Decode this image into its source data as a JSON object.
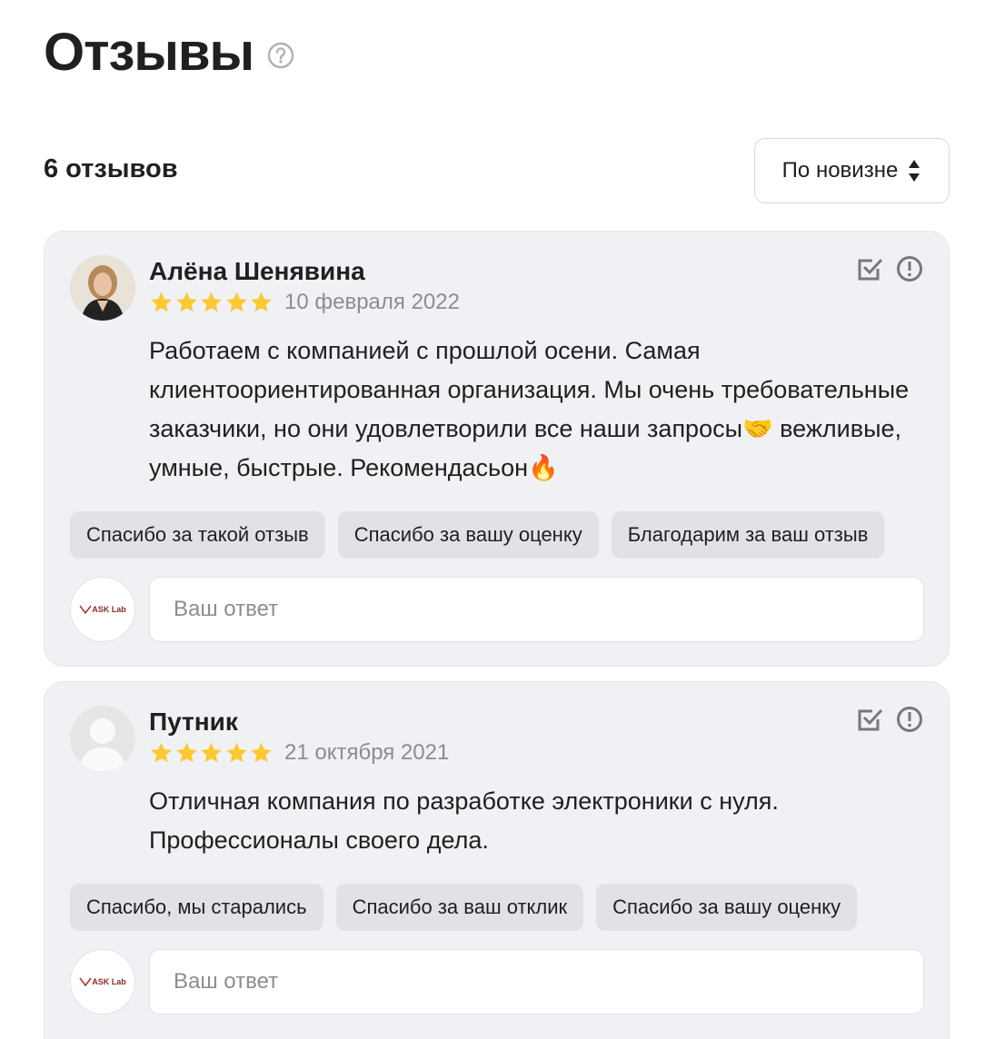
{
  "header": {
    "title": "Отзывы",
    "help_icon": "question-circle-icon"
  },
  "summary": {
    "count_label": "6 отзывов",
    "sort_label": "По новизне",
    "sort_icon": "sort-arrows-icon"
  },
  "colors": {
    "star": "#fcc934",
    "card_background": "#f0f1f4",
    "chip_background": "#e0e2e7",
    "muted_text": "#8c8d93"
  },
  "reviews": [
    {
      "author": "Алёна Шенявина",
      "rating": 5,
      "date": "10 февраля 2022",
      "text": "Работаем с компанией с прошлой осени. Самая клиентоориентированная организация. Мы очень требовательные заказчики, но они удовлетворили все наши запросы🤝 вежливые, умные, быстрые. Рекомендасьон🔥",
      "quick_replies": [
        "Спасибо за такой отзыв",
        "Спасибо за вашу оценку",
        "Благодарим за ваш отзыв"
      ],
      "reply_placeholder": "Ваш ответ",
      "company_logo": "ASK Lab"
    },
    {
      "author": "Путник",
      "rating": 5,
      "date": "21 октября 2021",
      "text": "Отличная компания по разработке электроники с нуля. Профессионалы своего дела.",
      "quick_replies": [
        "Спасибо, мы старались",
        "Спасибо за ваш отклик",
        "Спасибо за вашу оценку"
      ],
      "reply_placeholder": "Ваш ответ",
      "company_logo": "ASK Lab"
    }
  ]
}
